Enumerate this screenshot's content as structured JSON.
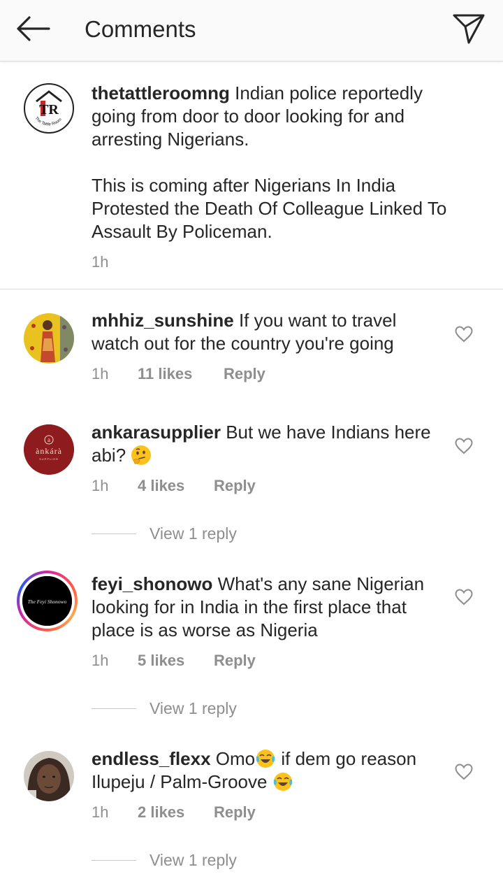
{
  "header": {
    "title": "Comments",
    "back_icon": "arrow-left-icon",
    "share_icon": "paper-plane-icon"
  },
  "caption": {
    "username": "thetattleroomng",
    "paragraph1": "Indian police reportedly going from door to door looking for and arresting Nigerians.",
    "paragraph2": "This is coming after Nigerians In India Protested the Death Of Colleague Linked To Assault By Policeman.",
    "time": "1h",
    "logo_letters": "TR",
    "logo_ring_text": "The Tattle Room"
  },
  "comments": [
    {
      "username": "mhhiz_sunshine",
      "text": "If you want to travel watch out for the country you're going",
      "time": "1h",
      "likes": "11 likes",
      "reply": "Reply"
    },
    {
      "username": "ankarasupplier",
      "text": "But we have Indians here abi?",
      "time": "1h",
      "likes": "4 likes",
      "reply": "Reply",
      "view_replies": "View 1 reply",
      "logo_letter": "a",
      "logo_word": "ànkárà",
      "logo_sub": "SUPPLIER"
    },
    {
      "username": "feyi_shonowo",
      "text": "What's any sane Nigerian looking for in India in the first place that place is as worse as Nigeria",
      "time": "1h",
      "likes": "5 likes",
      "reply": "Reply",
      "view_replies": "View 1 reply",
      "logo_script": "The Feyi Shonowo"
    },
    {
      "username": "endless_flexx",
      "text_part1": "Omo",
      "text_part2": " if dem go reason Ilupeju / Palm-Groove ",
      "time": "1h",
      "likes": "2 likes",
      "reply": "Reply",
      "view_replies": "View 1 reply"
    }
  ],
  "colors": {
    "text": "#262626",
    "secondary": "#8e8e8e",
    "divider": "#dbdbdb",
    "header_bg": "#fafafa"
  }
}
